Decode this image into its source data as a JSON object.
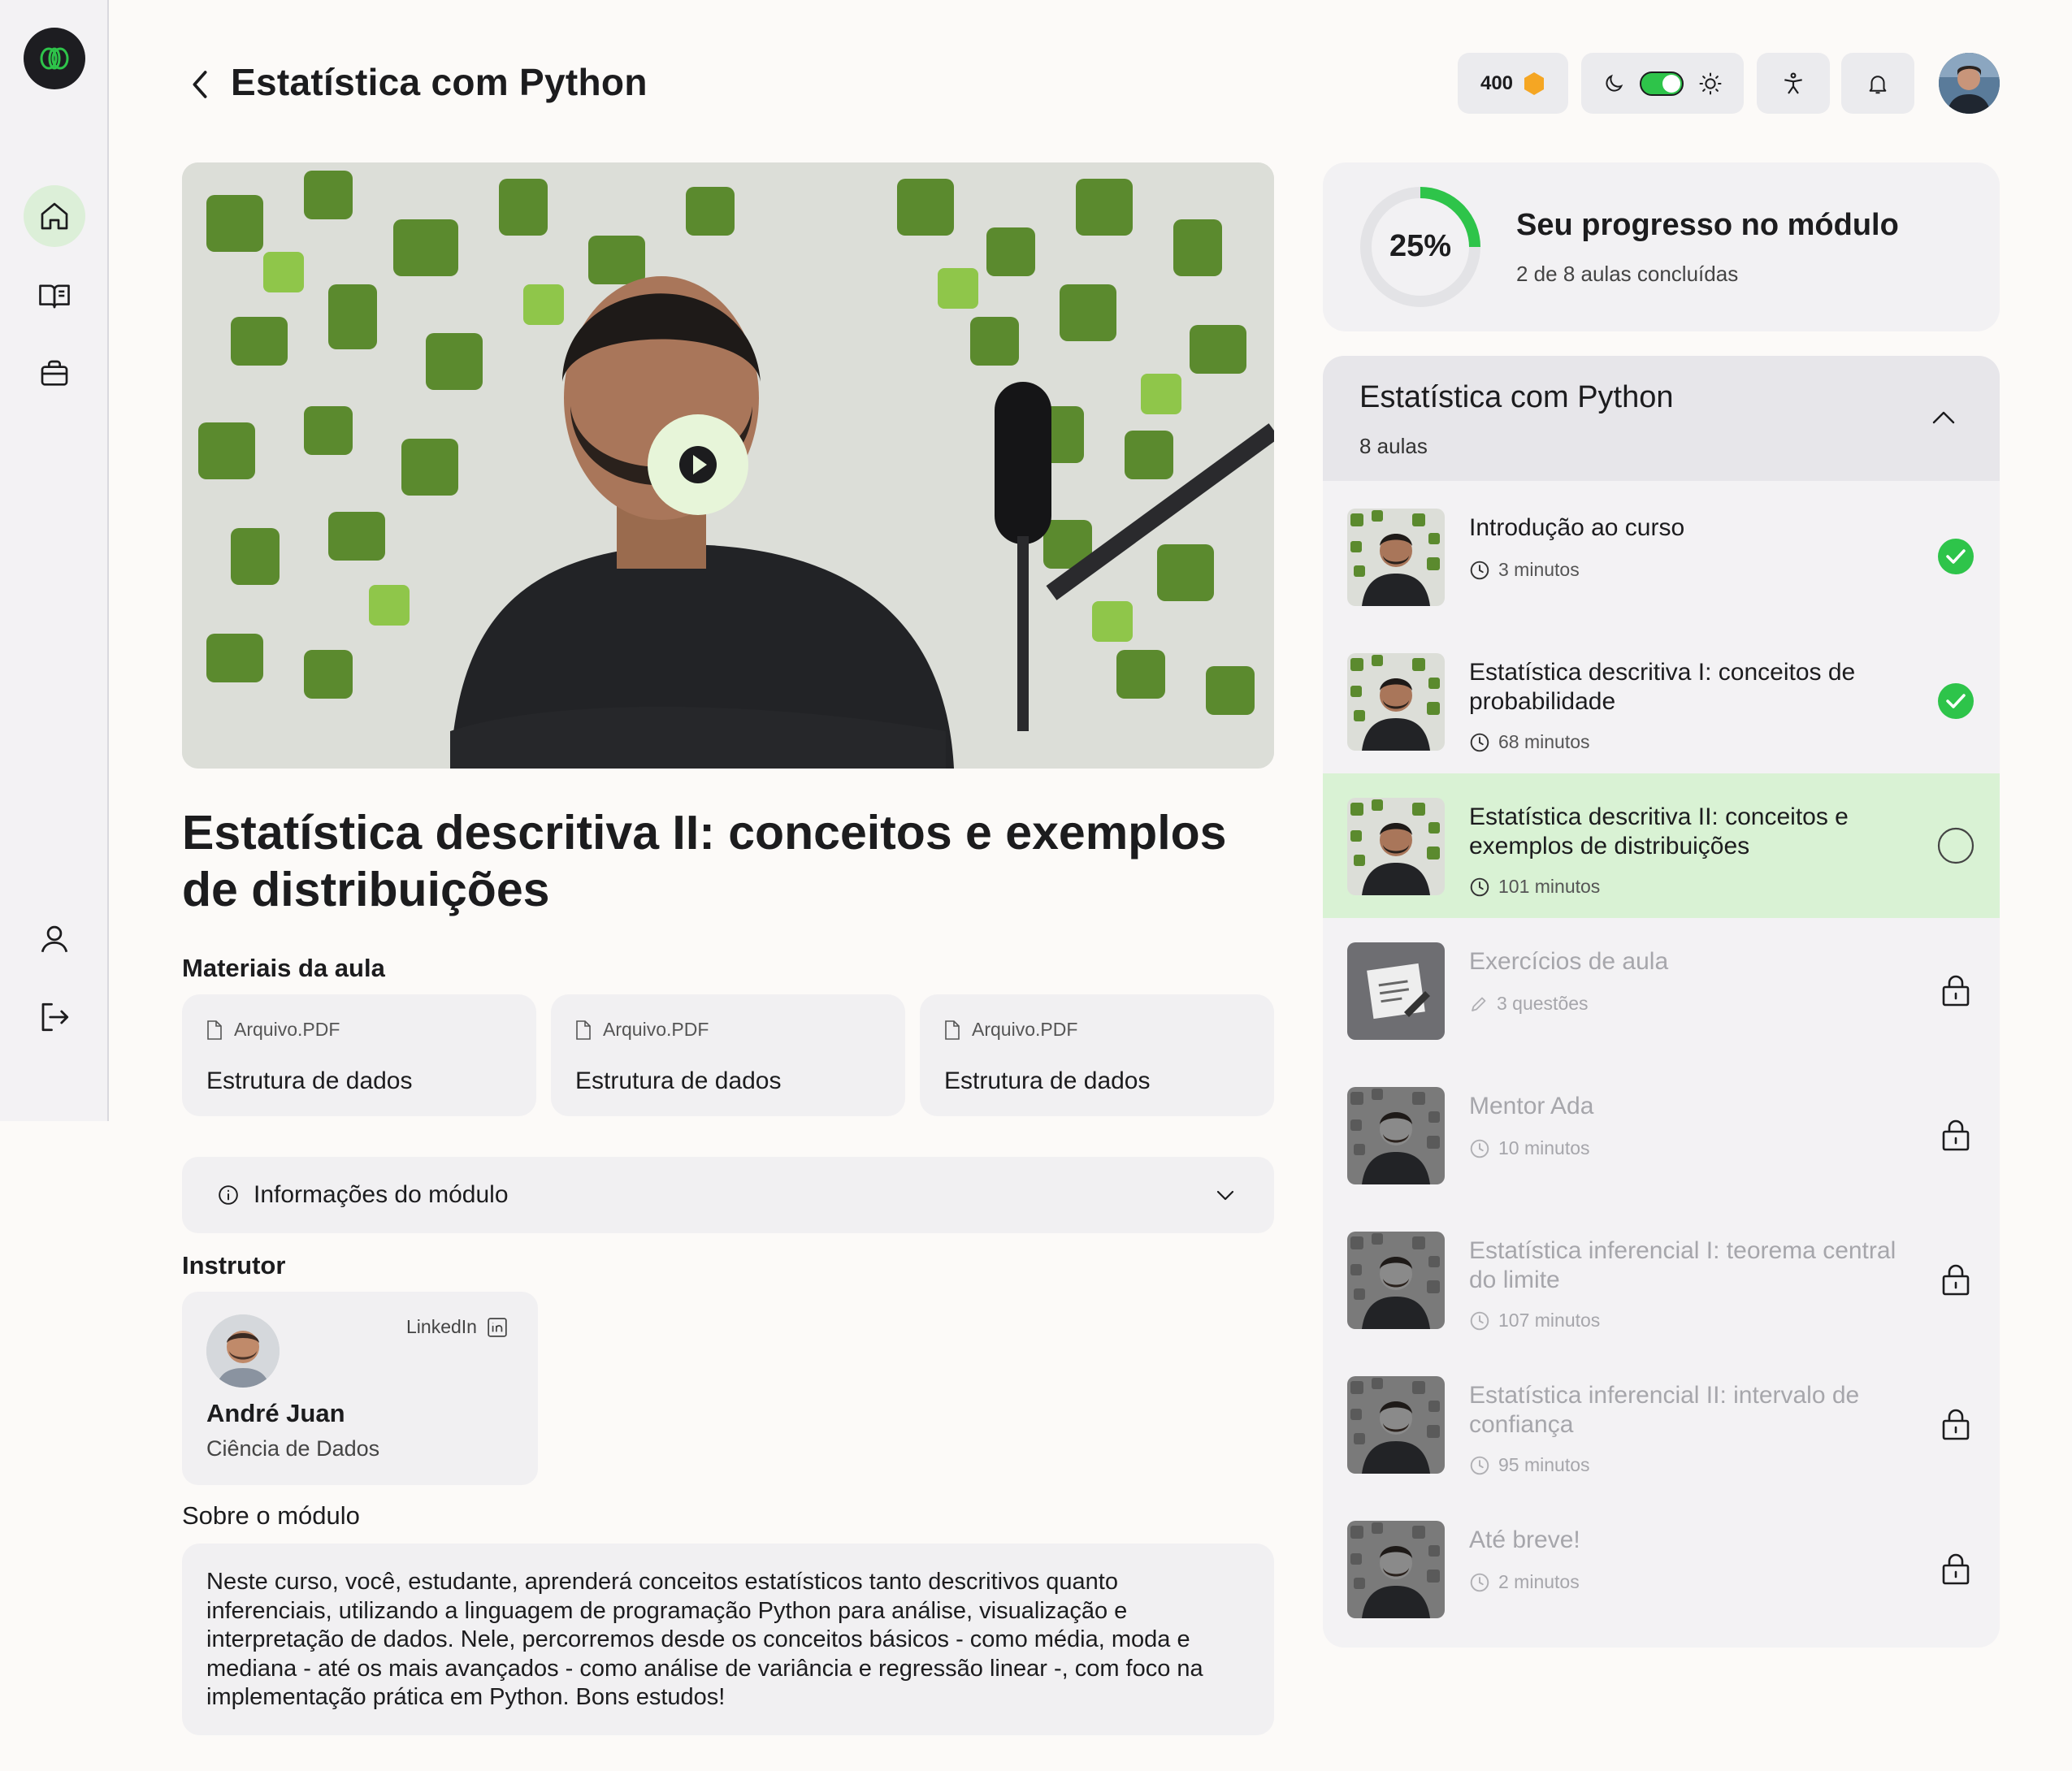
{
  "header": {
    "title": "Estatística com Python",
    "coins": "400"
  },
  "lesson": {
    "title": "Estatística descritiva II: conceitos e exemplos de distribuições",
    "materials_label": "Materiais da aula",
    "materials": [
      {
        "type": "Arquivo.PDF",
        "name": "Estrutura de dados"
      },
      {
        "type": "Arquivo.PDF",
        "name": "Estrutura de dados"
      },
      {
        "type": "Arquivo.PDF",
        "name": "Estrutura de dados"
      }
    ],
    "info_label": "Informações do módulo",
    "instructor_label": "Instrutor",
    "instructor": {
      "linkedin": "LinkedIn",
      "name": "André Juan",
      "area": "Ciência de Dados"
    },
    "about_label": "Sobre o módulo",
    "about_text": "Neste curso, você, estudante, aprenderá conceitos estatísticos tanto descritivos quanto inferenciais, utilizando a linguagem de programação Python para análise, visualização e interpretação de dados. Nele, percorremos desde os conceitos básicos - como média, moda e mediana - até os mais avançados - como análise de variância e regressão linear -, com foco na implementação prática em Python. Bons estudos!"
  },
  "progress": {
    "percent_label": "25%",
    "fraction": 0.25,
    "title": "Seu progresso no módulo",
    "subtitle": "2 de 8 aulas concluídas"
  },
  "module": {
    "title": "Estatística com Python",
    "count": "8 aulas",
    "lessons": [
      {
        "title": "Introdução ao curso",
        "meta": "3 minutos",
        "status": "done"
      },
      {
        "title": "Estatística descritiva I: conceitos de probabilidade",
        "meta": "68 minutos",
        "status": "done"
      },
      {
        "title": "Estatística descritiva II: conceitos e exemplos de distribuições",
        "meta": "101 minutos",
        "status": "current"
      },
      {
        "title": "Exercícios de aula",
        "meta": "3 questões",
        "status": "locked"
      },
      {
        "title": "Mentor Ada",
        "meta": "10 minutos",
        "status": "locked"
      },
      {
        "title": "Estatística inferencial I: teorema central do limite",
        "meta": "107 minutos",
        "status": "locked"
      },
      {
        "title": "Estatística inferencial II: intervalo de confiança",
        "meta": "95 minutos",
        "status": "locked"
      },
      {
        "title": "Até breve!",
        "meta": "2 minutos",
        "status": "locked"
      }
    ]
  },
  "colors": {
    "accent": "#2ec44a",
    "current_bg": "#d9f2d4",
    "active_nav": "#dcefd8",
    "coin": "#f5a623"
  },
  "icons": [
    "logo-icon",
    "home-icon",
    "book-icon",
    "briefcase-icon",
    "user-icon",
    "logout-icon",
    "back-arrow-icon",
    "coin-icon",
    "moon-icon",
    "toggle-switch",
    "sun-icon",
    "accessibility-icon",
    "bell-icon",
    "play-icon",
    "file-icon",
    "info-icon",
    "chevron-down-icon",
    "linkedin-icon",
    "chevron-up-icon",
    "clock-icon",
    "pencil-icon",
    "check-circle-icon",
    "empty-circle-icon",
    "lock-icon"
  ]
}
